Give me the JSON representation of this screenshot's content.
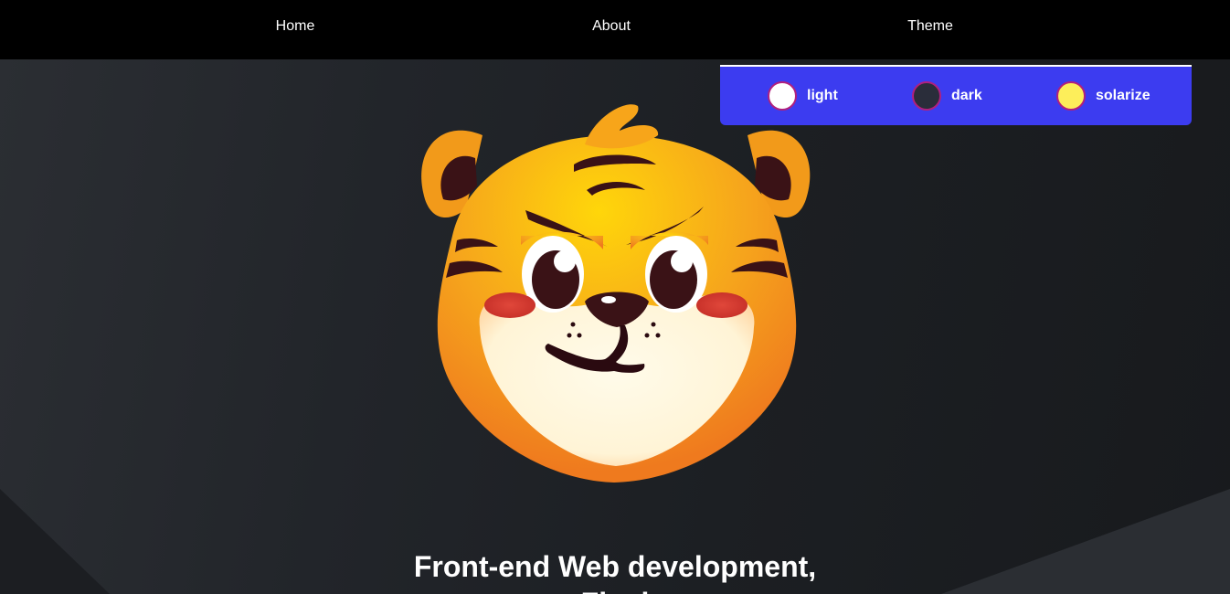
{
  "nav": {
    "home": "Home",
    "about": "About",
    "theme": "Theme"
  },
  "theme_menu": {
    "options": [
      {
        "label": "light",
        "color": "#ffffff"
      },
      {
        "label": "dark",
        "color": "#2a2d3a"
      },
      {
        "label": "solarize",
        "color": "#fdee5a"
      }
    ],
    "panel_color": "#3c3cf0"
  },
  "hero": {
    "title_line1": "Front-end Web development,",
    "title_line2": "Final"
  },
  "colors": {
    "nav_bg": "#000000",
    "page_bg": "#1f2226",
    "accent": "#3c3cf0"
  }
}
